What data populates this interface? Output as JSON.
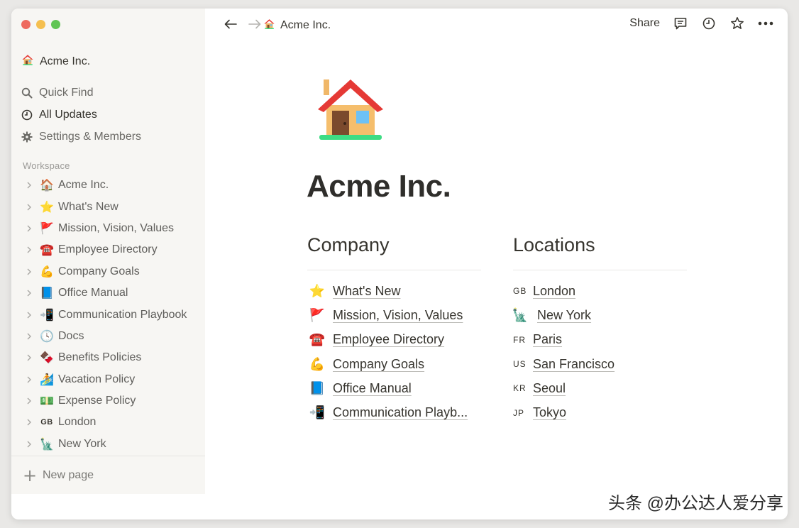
{
  "workspace": {
    "name": "Acme Inc."
  },
  "sidebar": {
    "menu": [
      {
        "label": "Quick Find",
        "icon": "search-icon"
      },
      {
        "label": "All Updates",
        "icon": "clock-icon"
      },
      {
        "label": "Settings & Members",
        "icon": "gear-icon"
      }
    ],
    "section_label": "Workspace",
    "tree": [
      {
        "label": "Acme Inc.",
        "emoji": "🏠",
        "icon": "house-icon"
      },
      {
        "label": "What's New",
        "emoji": "⭐",
        "icon": "star-icon"
      },
      {
        "label": "Mission, Vision, Values",
        "emoji": "🚩",
        "icon": "flag-icon"
      },
      {
        "label": "Employee Directory",
        "emoji": "☎️",
        "icon": "telephone-icon"
      },
      {
        "label": "Company Goals",
        "emoji": "💪",
        "icon": "flexed-arm-icon"
      },
      {
        "label": "Office Manual",
        "emoji": "📘",
        "icon": "blue-book-icon"
      },
      {
        "label": "Communication Playbook",
        "emoji": "📲",
        "icon": "mobile-phone-icon"
      },
      {
        "label": "Docs",
        "emoji": "🕓",
        "icon": "clock-icon"
      },
      {
        "label": "Benefits Policies",
        "emoji": "🍫",
        "icon": "benefits-icon"
      },
      {
        "label": "Vacation Policy",
        "emoji": "🏄",
        "icon": "surfer-icon"
      },
      {
        "label": "Expense Policy",
        "emoji": "💵",
        "icon": "money-icon"
      },
      {
        "label": "London",
        "code": "GB",
        "icon": "gb-flag-icon"
      },
      {
        "label": "New York",
        "emoji": "🗽",
        "icon": "statue-of-liberty-icon"
      }
    ],
    "new_page_label": "New page"
  },
  "topbar": {
    "breadcrumb": "Acme Inc.",
    "share_label": "Share"
  },
  "page": {
    "title": "Acme Inc.",
    "company": {
      "heading": "Company",
      "links": [
        {
          "label": "What's New",
          "emoji": "⭐"
        },
        {
          "label": "Mission, Vision, Values",
          "emoji": "🚩"
        },
        {
          "label": "Employee Directory",
          "emoji": "☎️"
        },
        {
          "label": "Company Goals",
          "emoji": "💪"
        },
        {
          "label": "Office Manual",
          "emoji": "📘"
        },
        {
          "label": "Communication Playb...",
          "emoji": "📲"
        }
      ]
    },
    "locations": {
      "heading": "Locations",
      "links": [
        {
          "label": "London",
          "code": "GB"
        },
        {
          "label": "New York",
          "emoji": "🗽"
        },
        {
          "label": "Paris",
          "code": "FR"
        },
        {
          "label": "San Francisco",
          "code": "US"
        },
        {
          "label": "Seoul",
          "code": "KR"
        },
        {
          "label": "Tokyo",
          "code": "JP"
        }
      ]
    }
  },
  "watermark": "头条 @办公达人爱分享",
  "colors": {
    "sidebar_bg": "#f7f6f3",
    "text": "#37352f",
    "muted": "#6b6a66",
    "traffic_red": "#ee6a5f",
    "traffic_yellow": "#f5bf4f",
    "traffic_green": "#61c554"
  }
}
